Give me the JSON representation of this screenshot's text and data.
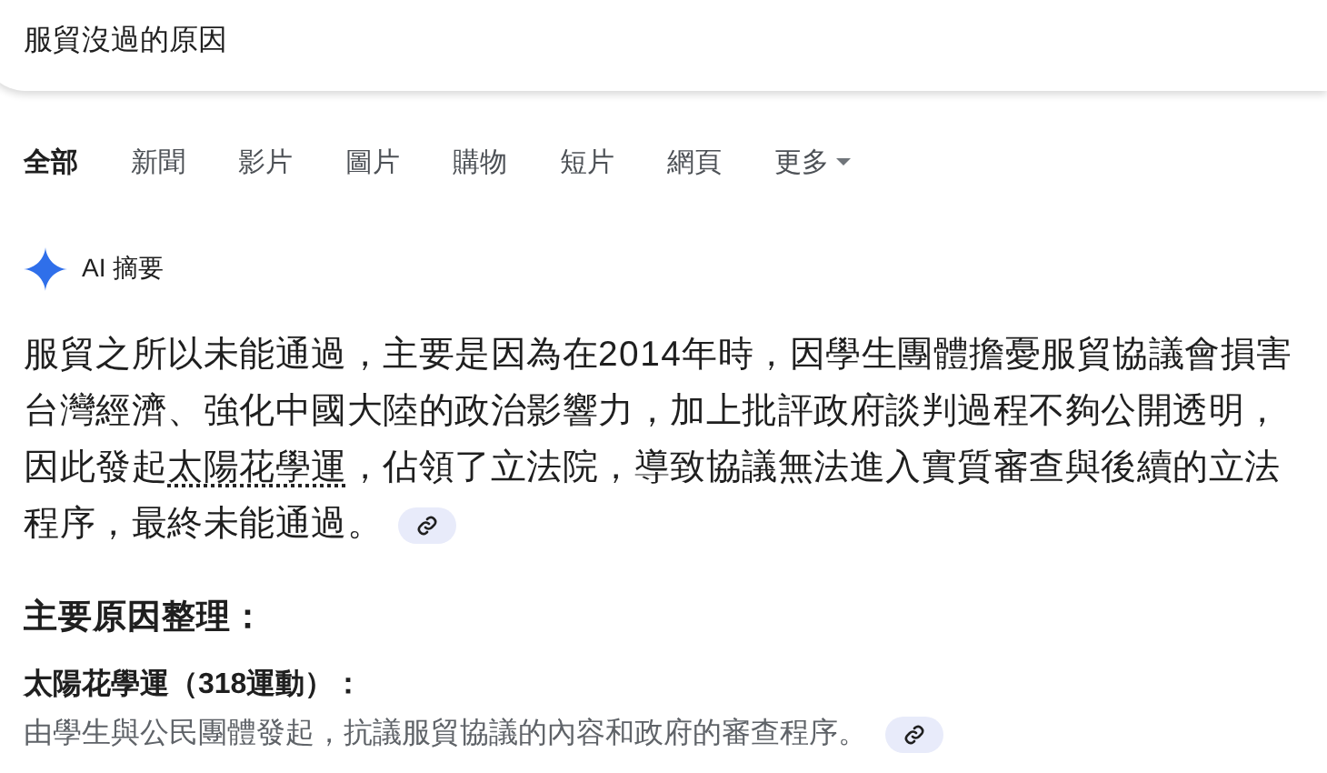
{
  "search": {
    "value": "服貿沒過的原因"
  },
  "tabs": [
    {
      "label": "全部",
      "selected": true
    },
    {
      "label": "新聞",
      "selected": false
    },
    {
      "label": "影片",
      "selected": false
    },
    {
      "label": "圖片",
      "selected": false
    },
    {
      "label": "購物",
      "selected": false
    },
    {
      "label": "短片",
      "selected": false
    },
    {
      "label": "網頁",
      "selected": false
    },
    {
      "label": "更多",
      "selected": false,
      "kind": "menu"
    }
  ],
  "ai_overview": {
    "title": "AI 摘要",
    "summary": {
      "before": "服貿之所以未能通過，主要是因為在2014年時，因學生團體擔憂服貿協議會損害台灣經濟、強化中國大陸的政治影響力，加上批評政府談判過程不夠公開透明，因此發起",
      "link": "太陽花學運",
      "after": "，佔領了立法院，導致協議無法進入實質審查與後續的立法程序，最終未能通過。"
    },
    "section_heading": "主要原因整理：",
    "reasons": [
      {
        "title": "太陽花學運（318運動）：",
        "detail": "由學生與公民團體發起，抗議服貿協議的內容和政府的審查程序。"
      }
    ]
  }
}
